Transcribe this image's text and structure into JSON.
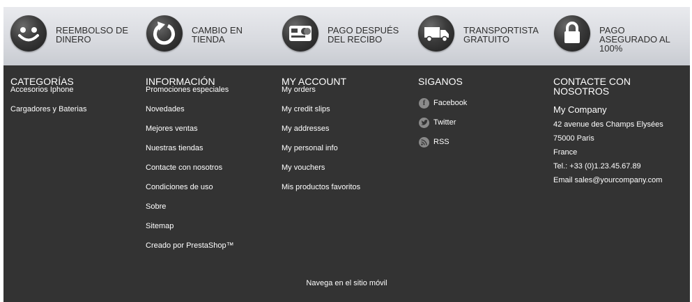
{
  "reassurance": [
    {
      "icon": "smiley-icon",
      "label": "REEMBOLSO DE DINERO"
    },
    {
      "icon": "refresh-icon",
      "label": "CAMBIO EN TIENDA"
    },
    {
      "icon": "credit-card-icon",
      "label": "PAGO DESPUÉS DEL RECIBO"
    },
    {
      "icon": "truck-icon",
      "label": "TRANSPORTISTA GRATUITO"
    },
    {
      "icon": "lock-icon",
      "label": "PAGO ASEGURADO AL 100%"
    }
  ],
  "footer": {
    "categories": {
      "title": "CATEGORÍAS",
      "items": [
        "Accesorios Iphone",
        "Cargadores y Baterias"
      ]
    },
    "information": {
      "title": "INFORMACIÓN",
      "items": [
        "Promociones especiales",
        "Novedades",
        "Mejores ventas",
        "Nuestras tiendas",
        "Contacte con nosotros",
        "Condiciones de uso",
        "Sobre",
        "Sitemap",
        "Creado por PrestaShop™"
      ]
    },
    "account": {
      "title": "MY ACCOUNT",
      "items": [
        "My orders",
        "My credit slips",
        "My addresses",
        "My personal info",
        "My vouchers",
        "Mis productos favoritos"
      ]
    },
    "social": {
      "title": "SIGANOS",
      "items": [
        {
          "icon": "facebook-icon",
          "label": "Facebook"
        },
        {
          "icon": "twitter-icon",
          "label": "Twitter"
        },
        {
          "icon": "rss-icon",
          "label": "RSS"
        }
      ]
    },
    "contact": {
      "title": "CONTACTE CON NOSOTROS",
      "company": "My Company",
      "address": "42 avenue des Champs Elysées",
      "postal": "75000 Paris",
      "country": "France",
      "phone": "Tel.: +33 (0)1.23.45.67.89",
      "email": "Email sales@yourcompany.com"
    },
    "mobile_link": "Navega en el sitio móvil"
  }
}
